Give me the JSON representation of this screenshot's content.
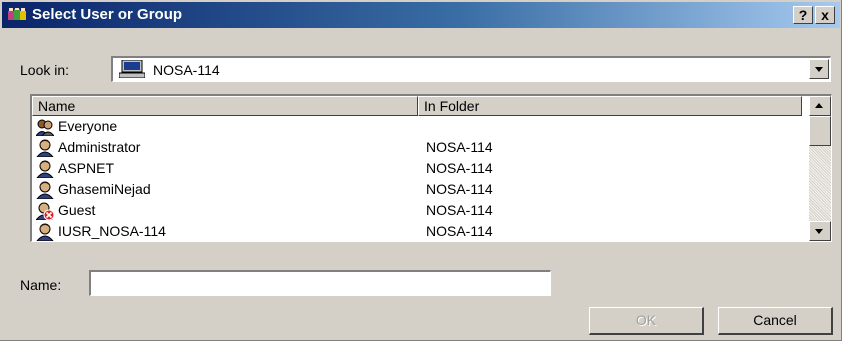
{
  "window": {
    "title": "Select User or Group",
    "help_button": "?",
    "close_button": "x"
  },
  "look_in": {
    "label": "Look in:",
    "value": "NOSA-114"
  },
  "list": {
    "columns": [
      "Name",
      "In Folder"
    ],
    "rows": [
      {
        "name": "Everyone",
        "folder": "",
        "icon": "group-icon"
      },
      {
        "name": "Administrator",
        "folder": "NOSA-114",
        "icon": "user-icon"
      },
      {
        "name": "ASPNET",
        "folder": "NOSA-114",
        "icon": "user-icon"
      },
      {
        "name": "GhasemiNejad",
        "folder": "NOSA-114",
        "icon": "user-icon"
      },
      {
        "name": "Guest",
        "folder": "NOSA-114",
        "icon": "disabled-user-icon"
      },
      {
        "name": "IUSR_NOSA-114",
        "folder": "NOSA-114",
        "icon": "user-icon"
      }
    ]
  },
  "name_field": {
    "label": "Name:",
    "value": ""
  },
  "buttons": {
    "ok": "OK",
    "cancel": "Cancel"
  },
  "colors": {
    "titlebar_start": "#0a246a",
    "titlebar_end": "#a6caf0",
    "face": "#d4d0c8"
  }
}
